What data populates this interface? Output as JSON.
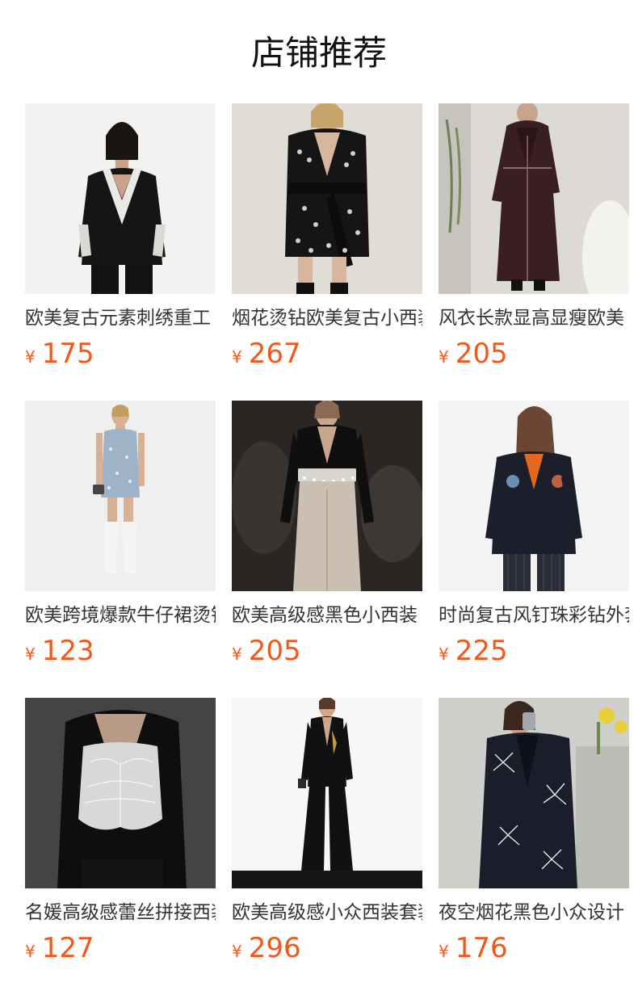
{
  "page_title": "店铺推荐",
  "currency_symbol": "¥",
  "accent_color": "#f2571b",
  "products": [
    {
      "title": "欧美复古元素刺绣重工",
      "price": "175",
      "image": "black-embroidered-blazer-photo"
    },
    {
      "title": "烟花烫钻欧美复古小西装",
      "price": "267",
      "image": "black-rhinestone-blazer-dress-photo"
    },
    {
      "title": "风衣长款显高显瘦欧美",
      "price": "205",
      "image": "burgundy-long-trench-coat-photo"
    },
    {
      "title": "欧美跨境爆款牛仔裙烫钻",
      "price": "123",
      "image": "denim-mini-dress-photo"
    },
    {
      "title": "欧美高级感黑色小西装",
      "price": "205",
      "image": "black-top-sequin-trousers-photo"
    },
    {
      "title": "时尚复古风钉珠彩钻外套",
      "price": "225",
      "image": "embellished-black-blazer-photo"
    },
    {
      "title": "名媛高级感蕾丝拼接西装",
      "price": "127",
      "image": "lace-corset-blazer-photo"
    },
    {
      "title": "欧美高级感小众西装套装",
      "price": "296",
      "image": "black-flared-suit-photo"
    },
    {
      "title": "夜空烟花黑色小众设计",
      "price": "176",
      "image": "firework-embroidered-suit-photo"
    }
  ]
}
